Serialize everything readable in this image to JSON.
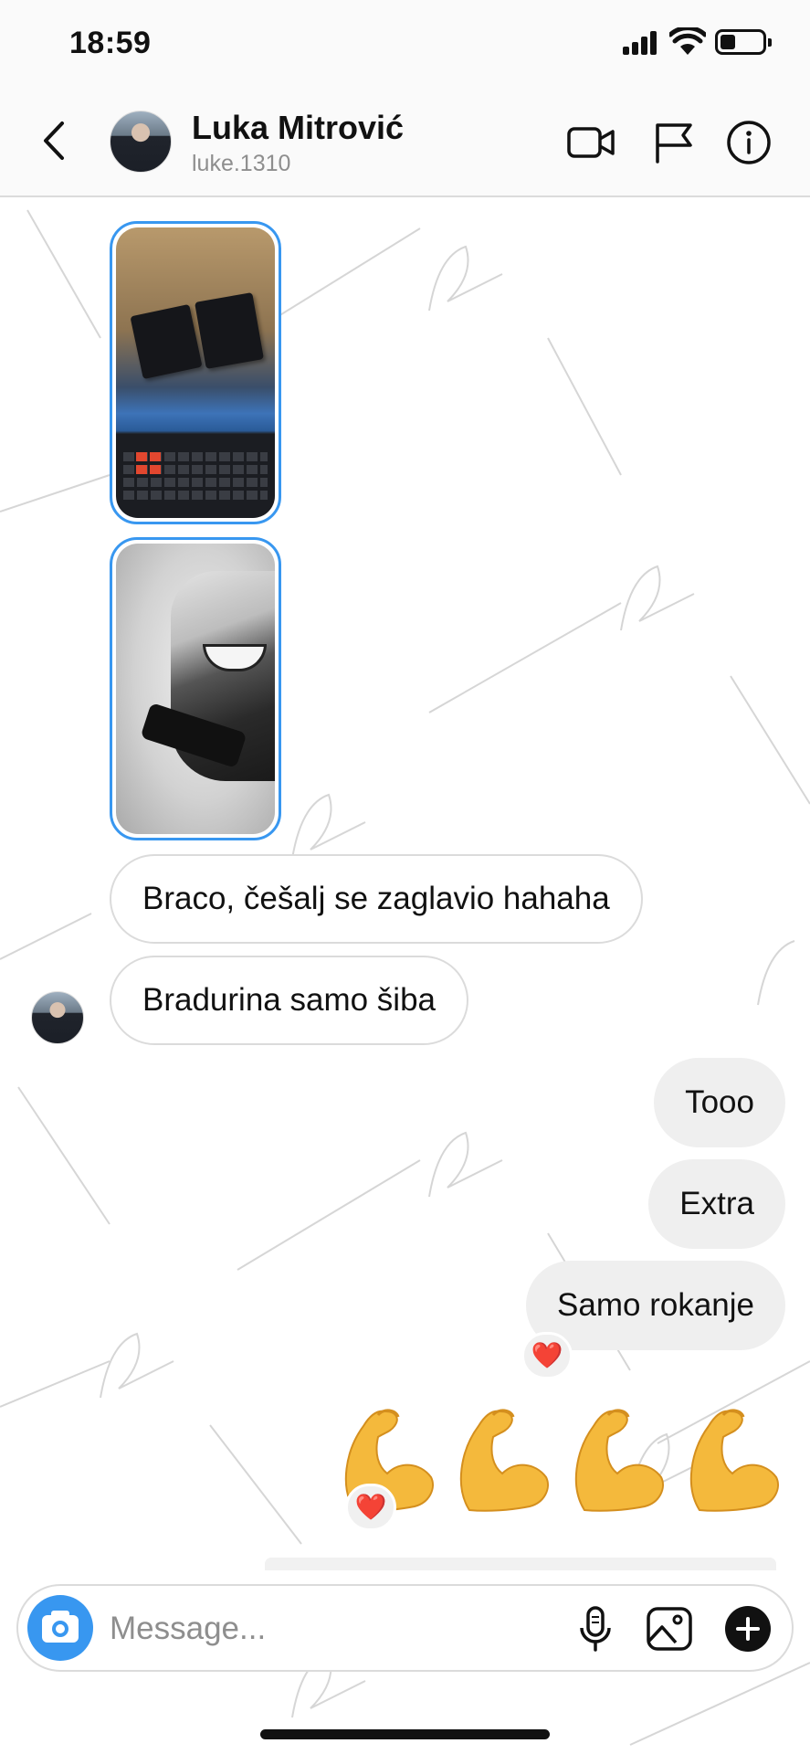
{
  "status_bar": {
    "time": "18:59"
  },
  "header": {
    "contact_name": "Luka Mitrović",
    "username": "luke.1310",
    "icons": [
      "back-chevron-icon",
      "video-camera-icon",
      "flag-icon",
      "info-icon"
    ]
  },
  "messages": {
    "incoming": [
      {
        "text": "Braco, češalj se zaglavio hahaha"
      },
      {
        "text": "Bradurina samo šiba"
      }
    ],
    "outgoing": [
      {
        "text": "Tooo"
      },
      {
        "text": "Extra"
      },
      {
        "text": "Samo rokanje",
        "reaction": "❤️"
      },
      {
        "emoji": "💪💪💪💪",
        "reaction": "❤️"
      }
    ]
  },
  "composer": {
    "placeholder": "Message...",
    "icons": [
      "camera-icon",
      "microphone-icon",
      "gallery-icon",
      "plus-icon"
    ]
  },
  "colors": {
    "accent": "#3897f0",
    "incoming_border": "#dbdbdb",
    "outgoing_bg": "#efefef",
    "reaction_heart": "#e8173c"
  }
}
